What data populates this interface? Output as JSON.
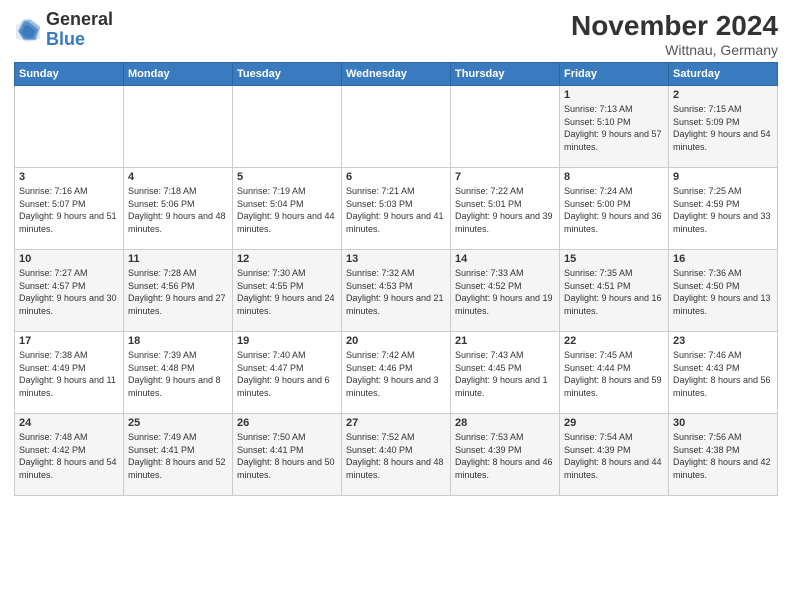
{
  "logo": {
    "line1": "General",
    "line2": "Blue"
  },
  "title": "November 2024",
  "location": "Wittnau, Germany",
  "days_of_week": [
    "Sunday",
    "Monday",
    "Tuesday",
    "Wednesday",
    "Thursday",
    "Friday",
    "Saturday"
  ],
  "weeks": [
    [
      {
        "day": "",
        "info": ""
      },
      {
        "day": "",
        "info": ""
      },
      {
        "day": "",
        "info": ""
      },
      {
        "day": "",
        "info": ""
      },
      {
        "day": "",
        "info": ""
      },
      {
        "day": "1",
        "info": "Sunrise: 7:13 AM\nSunset: 5:10 PM\nDaylight: 9 hours and 57 minutes."
      },
      {
        "day": "2",
        "info": "Sunrise: 7:15 AM\nSunset: 5:09 PM\nDaylight: 9 hours and 54 minutes."
      }
    ],
    [
      {
        "day": "3",
        "info": "Sunrise: 7:16 AM\nSunset: 5:07 PM\nDaylight: 9 hours and 51 minutes."
      },
      {
        "day": "4",
        "info": "Sunrise: 7:18 AM\nSunset: 5:06 PM\nDaylight: 9 hours and 48 minutes."
      },
      {
        "day": "5",
        "info": "Sunrise: 7:19 AM\nSunset: 5:04 PM\nDaylight: 9 hours and 44 minutes."
      },
      {
        "day": "6",
        "info": "Sunrise: 7:21 AM\nSunset: 5:03 PM\nDaylight: 9 hours and 41 minutes."
      },
      {
        "day": "7",
        "info": "Sunrise: 7:22 AM\nSunset: 5:01 PM\nDaylight: 9 hours and 39 minutes."
      },
      {
        "day": "8",
        "info": "Sunrise: 7:24 AM\nSunset: 5:00 PM\nDaylight: 9 hours and 36 minutes."
      },
      {
        "day": "9",
        "info": "Sunrise: 7:25 AM\nSunset: 4:59 PM\nDaylight: 9 hours and 33 minutes."
      }
    ],
    [
      {
        "day": "10",
        "info": "Sunrise: 7:27 AM\nSunset: 4:57 PM\nDaylight: 9 hours and 30 minutes."
      },
      {
        "day": "11",
        "info": "Sunrise: 7:28 AM\nSunset: 4:56 PM\nDaylight: 9 hours and 27 minutes."
      },
      {
        "day": "12",
        "info": "Sunrise: 7:30 AM\nSunset: 4:55 PM\nDaylight: 9 hours and 24 minutes."
      },
      {
        "day": "13",
        "info": "Sunrise: 7:32 AM\nSunset: 4:53 PM\nDaylight: 9 hours and 21 minutes."
      },
      {
        "day": "14",
        "info": "Sunrise: 7:33 AM\nSunset: 4:52 PM\nDaylight: 9 hours and 19 minutes."
      },
      {
        "day": "15",
        "info": "Sunrise: 7:35 AM\nSunset: 4:51 PM\nDaylight: 9 hours and 16 minutes."
      },
      {
        "day": "16",
        "info": "Sunrise: 7:36 AM\nSunset: 4:50 PM\nDaylight: 9 hours and 13 minutes."
      }
    ],
    [
      {
        "day": "17",
        "info": "Sunrise: 7:38 AM\nSunset: 4:49 PM\nDaylight: 9 hours and 11 minutes."
      },
      {
        "day": "18",
        "info": "Sunrise: 7:39 AM\nSunset: 4:48 PM\nDaylight: 9 hours and 8 minutes."
      },
      {
        "day": "19",
        "info": "Sunrise: 7:40 AM\nSunset: 4:47 PM\nDaylight: 9 hours and 6 minutes."
      },
      {
        "day": "20",
        "info": "Sunrise: 7:42 AM\nSunset: 4:46 PM\nDaylight: 9 hours and 3 minutes."
      },
      {
        "day": "21",
        "info": "Sunrise: 7:43 AM\nSunset: 4:45 PM\nDaylight: 9 hours and 1 minute."
      },
      {
        "day": "22",
        "info": "Sunrise: 7:45 AM\nSunset: 4:44 PM\nDaylight: 8 hours and 59 minutes."
      },
      {
        "day": "23",
        "info": "Sunrise: 7:46 AM\nSunset: 4:43 PM\nDaylight: 8 hours and 56 minutes."
      }
    ],
    [
      {
        "day": "24",
        "info": "Sunrise: 7:48 AM\nSunset: 4:42 PM\nDaylight: 8 hours and 54 minutes."
      },
      {
        "day": "25",
        "info": "Sunrise: 7:49 AM\nSunset: 4:41 PM\nDaylight: 8 hours and 52 minutes."
      },
      {
        "day": "26",
        "info": "Sunrise: 7:50 AM\nSunset: 4:41 PM\nDaylight: 8 hours and 50 minutes."
      },
      {
        "day": "27",
        "info": "Sunrise: 7:52 AM\nSunset: 4:40 PM\nDaylight: 8 hours and 48 minutes."
      },
      {
        "day": "28",
        "info": "Sunrise: 7:53 AM\nSunset: 4:39 PM\nDaylight: 8 hours and 46 minutes."
      },
      {
        "day": "29",
        "info": "Sunrise: 7:54 AM\nSunset: 4:39 PM\nDaylight: 8 hours and 44 minutes."
      },
      {
        "day": "30",
        "info": "Sunrise: 7:56 AM\nSunset: 4:38 PM\nDaylight: 8 hours and 42 minutes."
      }
    ]
  ]
}
